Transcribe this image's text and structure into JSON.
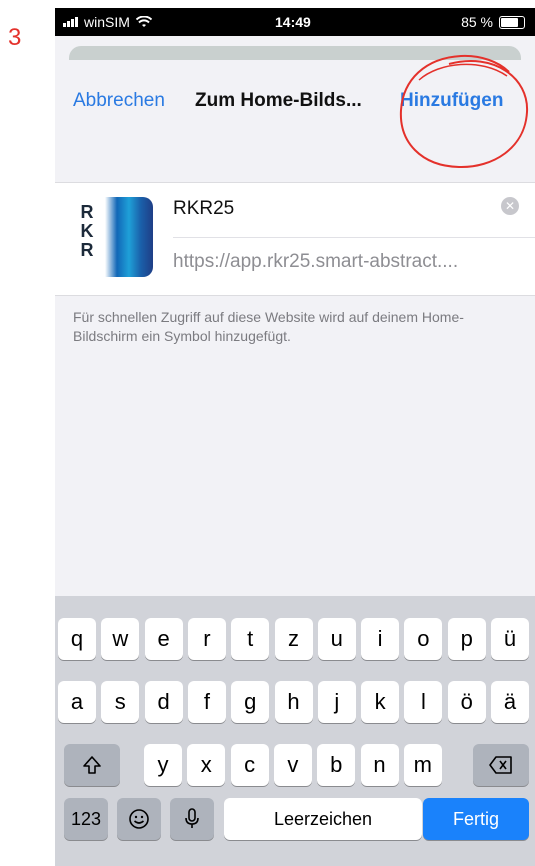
{
  "step_number": "3",
  "status_bar": {
    "carrier": "winSIM",
    "time": "14:49",
    "battery": "85 %",
    "battery_level": 0.85
  },
  "navbar": {
    "cancel_label": "Abbrechen",
    "title": "Zum Home-Bilds...",
    "add_label": "Hinzufügen",
    "annotation_color": "#e4312b"
  },
  "bookmark": {
    "icon_letters": [
      "R",
      "K",
      "R"
    ],
    "name_value": "RKR25",
    "url": "https://app.rkr25.smart-abstract....",
    "description": "Für schnellen Zugriff auf diese Website wird auf deinem Home-Bildschirm ein Symbol hinzugefügt."
  },
  "keyboard": {
    "row1": [
      "q",
      "w",
      "e",
      "r",
      "t",
      "z",
      "u",
      "i",
      "o",
      "p",
      "ü"
    ],
    "row2": [
      "a",
      "s",
      "d",
      "f",
      "g",
      "h",
      "j",
      "k",
      "l",
      "ö",
      "ä"
    ],
    "row3": [
      "y",
      "x",
      "c",
      "v",
      "b",
      "n",
      "m"
    ],
    "numbers_label": "123",
    "space_label": "Leerzeichen",
    "done_label": "Fertig"
  },
  "colors": {
    "accent": "#2a7ae2",
    "keyboard_done": "#1a82fb"
  }
}
